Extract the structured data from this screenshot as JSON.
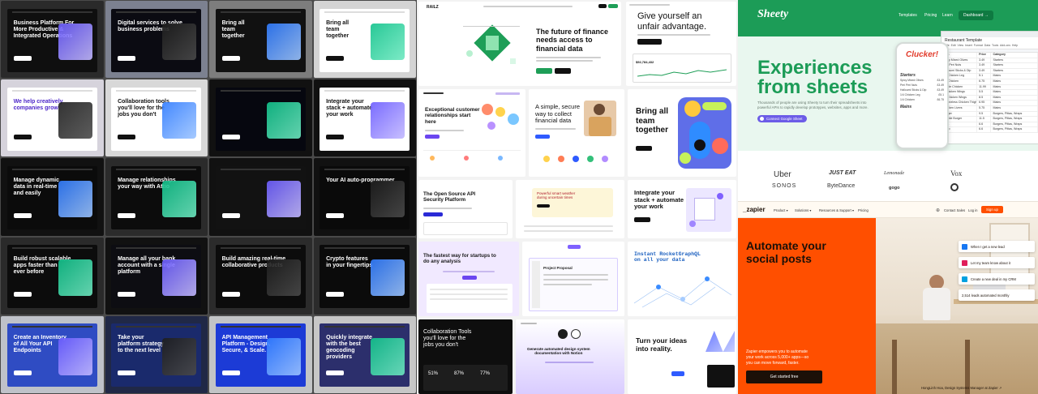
{
  "gallery_left": {
    "rows": [
      [
        {
          "title": "Business Platform For\nMore Productive &\nIntegrated Operations",
          "bg": "#2a2a2a",
          "card": "#0f0f0f",
          "fg": "#ffffff"
        },
        {
          "title": "Digital services to solve\nbusiness problems",
          "bg": "#7c8190",
          "card": "#0b0b12",
          "fg": "#ffffff"
        },
        {
          "title": "Bring all\nteam\ntogether",
          "bg": "#7d7d7d",
          "card": "#111111",
          "fg": "#ffffff"
        },
        {
          "title": "Bring all\nteam\ntogether",
          "bg": "#d4d4d4",
          "card": "#ffffff",
          "fg": "#111111"
        }
      ],
      [
        {
          "title": "We help creatively\ncompanies grow",
          "bg": "#d6d3dc",
          "card": "#ffffff",
          "fg": "#4d27c9"
        },
        {
          "title": "Collaboration tools\nyou'll love for the\njobs you don't",
          "bg": "#d8d8d8",
          "card": "#ffffff",
          "fg": "#111111"
        },
        {
          "title": "",
          "bg": "#111111",
          "card": "#06070f",
          "fg": "#ffffff"
        },
        {
          "title": "Integrate your\nstack + automate\nyour work",
          "bg": "#101010",
          "card": "#ffffff",
          "fg": "#111111"
        }
      ],
      [
        {
          "title": "Manage dynamic\ndata in real-time\nand easily",
          "bg": "#111111",
          "card": "#0b0b0b",
          "fg": "#ffffff"
        },
        {
          "title": "Manage relationships\nyour way with Attio",
          "bg": "#2b2b2b",
          "card": "#0c0c0c",
          "fg": "#ffffff"
        },
        {
          "title": "",
          "bg": "#111111",
          "card": "#121212",
          "fg": "#ffffff"
        },
        {
          "title": "Your AI auto-programmer",
          "bg": "#111111",
          "card": "#0a0a0a",
          "fg": "#ffffff"
        }
      ],
      [
        {
          "title": "Build robust scalable\napps faster than\never before",
          "bg": "#2a2a2a",
          "card": "#0c0c0c",
          "fg": "#ffffff"
        },
        {
          "title": "Manage all your bank\naccount with a single\nplatform",
          "bg": "#111111",
          "card": "#0d0d12",
          "fg": "#ffffff"
        },
        {
          "title": "Build amazing real-time\ncollaborative products",
          "bg": "#2b2b2b",
          "card": "#0c0c0c",
          "fg": "#ffffff"
        },
        {
          "title": "Crypto features\nin your fingertips",
          "bg": "#2b2b2b",
          "card": "#0b0b0b",
          "fg": "#ffffff"
        }
      ],
      [
        {
          "title": "Create an Inventory\nof All Your API\nEndpoints",
          "bg": "#bfc2c9",
          "card": "#2f4cc3",
          "fg": "#ffffff"
        },
        {
          "title": "Take your\nplatform strategy\nto the next level",
          "bg": "#202846",
          "card": "#1a2a6c",
          "fg": "#ffffff"
        },
        {
          "title": "API Management\nPlatform - Design,\nSecure, & Scale.",
          "bg": "#c2c4c6",
          "card": "#1c3bd6",
          "fg": "#ffffff"
        },
        {
          "title": "Quickly integrate\nwith the best\ngeocoding\nproviders",
          "bg": "#c7c7c7",
          "card": "#2c2f6c",
          "fg": "#ffffff"
        }
      ]
    ]
  },
  "gallery_mid": {
    "a": {
      "logo": "RAILZ",
      "title": "The future of finance\nneeds access to\nfinancial data",
      "btn1": "Get Started",
      "btn2": "Contact Sales"
    },
    "b": {
      "title": "Give yourself an\nunfair advantage.",
      "highlight": "unfair advantage.",
      "stat": "$92,784,432",
      "btn": "Try it for free"
    },
    "c": {
      "title": "Exceptional customer\nrelationships start\nhere"
    },
    "d": {
      "title": "A simple, secure\nway to collect\nfinancial data"
    },
    "e": {
      "title": "Bring all\nteam\ntogether"
    },
    "f": {
      "title": "The Open Source API\nSecurity Platform"
    },
    "g": {
      "title": "Powerful smart weather\nduring uncertain times"
    },
    "h": {
      "title": "Integrate your\nstack + automate\nyour work"
    },
    "i": {
      "title": "The fastest way for startups to\ndo any analysis",
      "underline": "any"
    },
    "j": {
      "title": "Project Proposal"
    },
    "k": {
      "title": "Instant RocketGraphQL\non all your data"
    },
    "l": {
      "title": "Collaboration Tools\nyou'll love for the\njobs you don't",
      "stats": [
        "51%",
        "87%",
        "77%"
      ]
    },
    "m": {
      "title": "Generate automated design system\ndocumentation with Notion"
    },
    "n": {
      "title": "Turn your ideas\ninto reality."
    }
  },
  "sheety": {
    "logo": "Sheety",
    "nav": [
      "Templates",
      "Pricing",
      "Learn"
    ],
    "dashboard": "Dashboard →",
    "headline": "Experiences\nfrom sheets",
    "sub": "Thousands of people are using Sheety to turn their spreadsheets into\npowerful APIs to rapidly develop prototypes, websites, apps and more.",
    "cta": "Connect Google Sheet",
    "sheet_title": "Restaurant Template",
    "sheet_menu": "File  Edit  View  Insert  Format  Data  Tools  Add-ons  Help",
    "columns": [
      "Item",
      "Price",
      "Category"
    ],
    "rows": [
      [
        "Spicy Mixed Olives",
        "3.49",
        "Starters"
      ],
      [
        "Peri Peri Nuts",
        "3.49",
        "Starters"
      ],
      [
        "Halloumi Sticks & Dip",
        "3.49",
        "Starters"
      ],
      [
        "1/4 Chicken Leg",
        "5.1",
        "Mains"
      ],
      [
        "1/4 Chicken",
        "6.75",
        "Mains"
      ],
      [
        "Whole Chicken",
        "11.99",
        "Mains"
      ],
      [
        "5 Chicken Wings",
        "5.5",
        "Mains"
      ],
      [
        "10 Chicken Wings",
        "8.5",
        "Mains"
      ],
      [
        "2 Boneless Chicken Thighs",
        "6.95",
        "Mains"
      ],
      [
        "Chicken Livers",
        "5.75",
        "Mains"
      ],
      [
        "Burger",
        "9.5",
        "Burgers, Pittas, Wraps"
      ],
      [
        "Double Burger",
        "11.5",
        "Burgers, Pittas, Wraps"
      ],
      [
        "Pitta",
        "6.6",
        "Burgers, Pittas, Wraps"
      ],
      [
        "Wrap",
        "6.6",
        "Burgers, Pittas, Wraps"
      ]
    ],
    "phone_title": "Clucker!",
    "phone_section1": "Starters",
    "phone_section2": "Mains",
    "phone_items": [
      [
        "Spicy Mixed Olives",
        "£3.49"
      ],
      [
        "Peri Peri Nuts",
        "£3.49"
      ],
      [
        "Halloumi Sticks & Dip",
        "£3.49"
      ],
      [
        "1/4 Chicken Leg",
        "£5.1"
      ],
      [
        "1/4 Chicken",
        "£6.75"
      ]
    ],
    "logos": [
      "Uber",
      "JUST EAT",
      "Lemonade",
      "Vox",
      "SONOS",
      "ByteDance",
      "gogo",
      ""
    ]
  },
  "zapier": {
    "logo": "_zapier",
    "nav": [
      "Product ▾",
      "Solutions ▾",
      "Resources & Support ▾",
      "Pricing"
    ],
    "right": [
      "Contact Sales",
      "Log in"
    ],
    "signup": "Sign up",
    "headline": "Automate your\nsocial posts",
    "sub": "Zapier empowers you to automate\nyour work across 5,000+ apps—so\nyou can move forward, faster.",
    "cta": "Get started free",
    "notifications": [
      "When I get a new lead",
      "Let my team know about it",
      "Create a new deal in my CRM",
      "2,514 leads automated monthly"
    ],
    "caption": "HongLinh Hoa, Design Systems Manager at Zapier ↗"
  },
  "colors": {
    "sheety_green": "#1c9c57",
    "zapier_orange": "#ff4f00",
    "gallery_bg": "#4a4a4a"
  }
}
